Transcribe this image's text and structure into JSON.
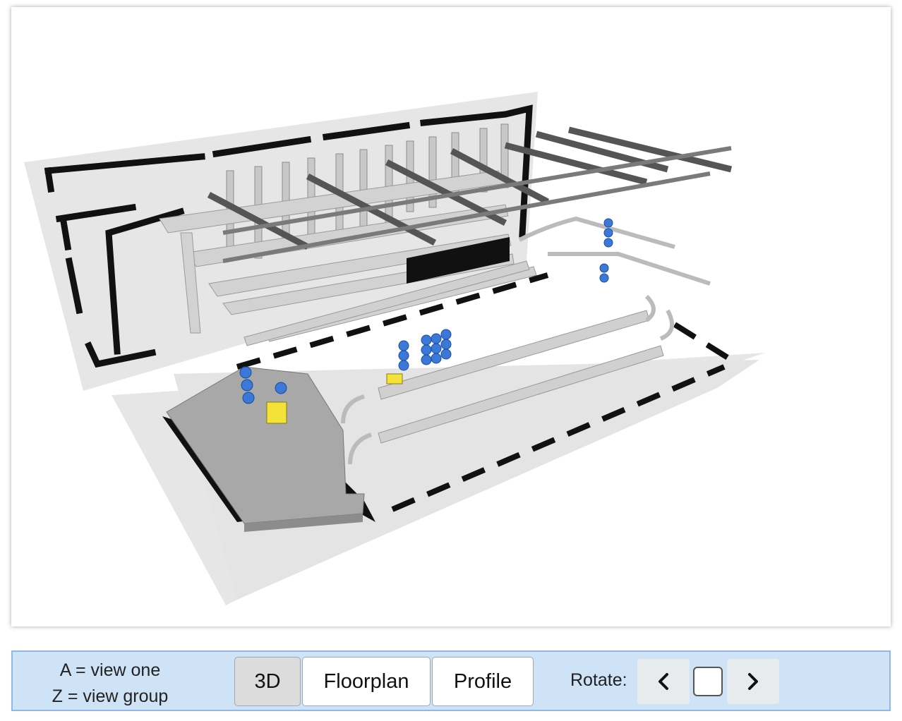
{
  "viewer": {
    "scene": "3d-station-model"
  },
  "toolbar": {
    "hint_line1": "A = view one",
    "hint_line2": "Z = view group",
    "view_buttons": [
      {
        "label": "3D",
        "active": true
      },
      {
        "label": "Floorplan",
        "active": false
      },
      {
        "label": "Profile",
        "active": false
      }
    ],
    "rotate_label": "Rotate:",
    "rotate_left_icon": "chevron-left-icon",
    "rotate_right_icon": "chevron-right-icon",
    "rotate_checkbox_checked": false
  },
  "colors": {
    "toolbar_bg": "#cfe3f7",
    "toolbar_border": "#8fb8e6",
    "agent_blue": "#3b78d8",
    "highlight_yellow": "#f2e23a"
  }
}
